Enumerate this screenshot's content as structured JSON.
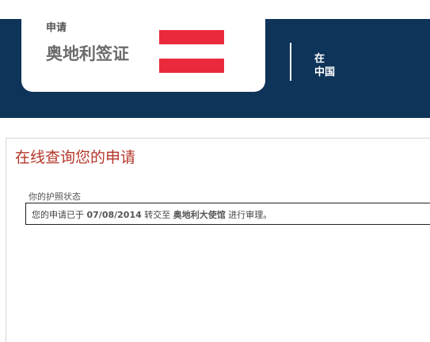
{
  "header": {
    "title_small": "申请",
    "title_big": "奥地利签证",
    "right_line1": "在",
    "right_line2": "中国",
    "flag_colors": [
      "#ea2a3c",
      "#ffffff",
      "#ea2a3c"
    ],
    "brand_color": "#0f3459"
  },
  "main": {
    "title": "在线查询您的申请",
    "status_label": "你的护照状态",
    "status_prefix": "您的申请已于",
    "status_date": "07/08/2014",
    "status_middle": "转交至",
    "status_place": "奥地利大使馆",
    "status_suffix": "进行审理。"
  }
}
